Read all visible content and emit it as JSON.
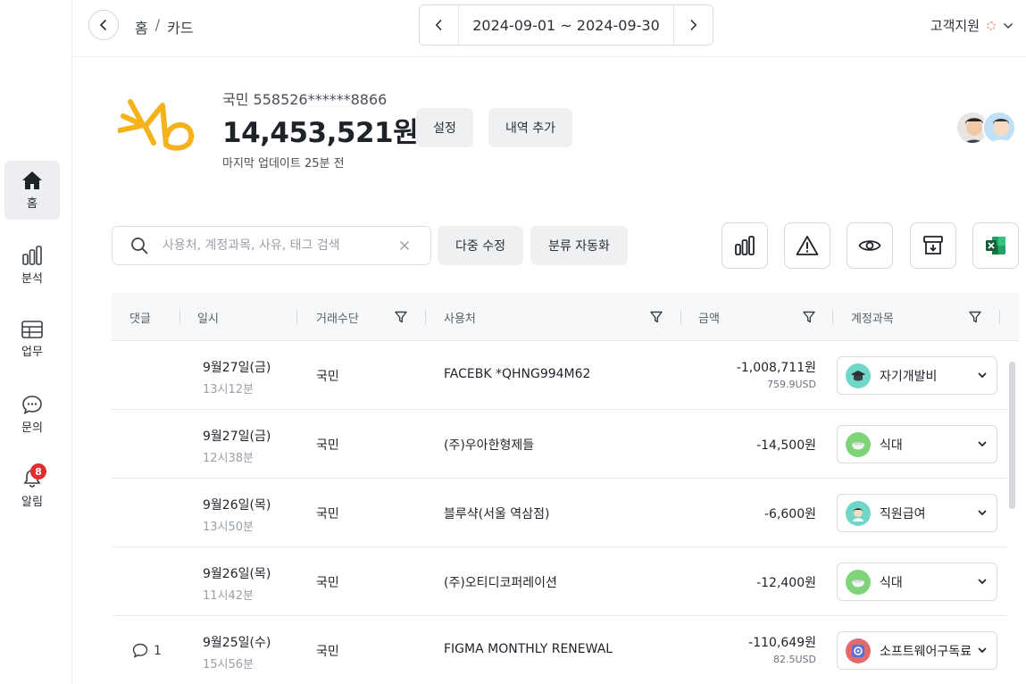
{
  "sidebar": {
    "items": [
      {
        "label": "홈",
        "icon": "home-icon",
        "active": true
      },
      {
        "label": "분석",
        "icon": "bar-chart-icon"
      },
      {
        "label": "업무",
        "icon": "table-icon"
      },
      {
        "label": "문의",
        "icon": "chat-icon"
      },
      {
        "label": "알림",
        "icon": "bell-icon",
        "badge": "8"
      }
    ]
  },
  "header": {
    "breadcrumb": [
      "홈",
      "/",
      "카드"
    ],
    "date_range": "2024-09-01 ~ 2024-09-30",
    "support_label": "고객지원"
  },
  "account": {
    "name": "국민 558526******8866",
    "balance": "14,453,521원",
    "updated": "마지막 업데이트 25분 전",
    "settings_label": "설정",
    "add_label": "내역 추가"
  },
  "toolbar": {
    "search_placeholder": "사용처, 계정과목, 사유, 태그 검색",
    "bulk_edit_label": "다중 수정",
    "auto_classify_label": "분류 자동화"
  },
  "table": {
    "headers": [
      "댓글",
      "일시",
      "거래수단",
      "사용처",
      "금액",
      "계정과목"
    ],
    "rows": [
      {
        "comment": "",
        "date": "9월27일(금)",
        "time": "13시12분",
        "method": "국민",
        "merchant": "FACEBK *QHNG994M62",
        "amount": "-1,008,711원",
        "amount_sub": "759.9USD",
        "category": "자기개발비",
        "cat_icon": "graduation-cap-icon",
        "cat_color": "#6fd6c8"
      },
      {
        "comment": "",
        "date": "9월27일(금)",
        "time": "12시38분",
        "method": "국민",
        "merchant": "(주)우아한형제들",
        "amount": "-14,500원",
        "amount_sub": "",
        "category": "식대",
        "cat_icon": "bowl-icon",
        "cat_color": "#7fd47a"
      },
      {
        "comment": "",
        "date": "9월26일(목)",
        "time": "13시50분",
        "method": "국민",
        "merchant": "블루샥(서울 역삼점)",
        "amount": "-6,600원",
        "amount_sub": "",
        "category": "직원급여",
        "cat_icon": "employee-icon",
        "cat_color": "#6fd6c8"
      },
      {
        "comment": "",
        "date": "9월26일(목)",
        "time": "11시42분",
        "method": "국민",
        "merchant": "(주)오티디코퍼레이션",
        "amount": "-12,400원",
        "amount_sub": "",
        "category": "식대",
        "cat_icon": "bowl-icon",
        "cat_color": "#7fd47a"
      },
      {
        "comment": "1",
        "date": "9월25일(수)",
        "time": "15시56분",
        "method": "국민",
        "merchant": "FIGMA MONTHLY RENEWAL",
        "amount": "-110,649원",
        "amount_sub": "82.5USD",
        "category": "소프트웨어구독료",
        "cat_icon": "software-icon",
        "cat_color": "#e36a6a"
      }
    ]
  },
  "colors": {
    "brand_logo": "#f5b21b",
    "badge": "#e02d2d",
    "excel": "#1d7044"
  }
}
